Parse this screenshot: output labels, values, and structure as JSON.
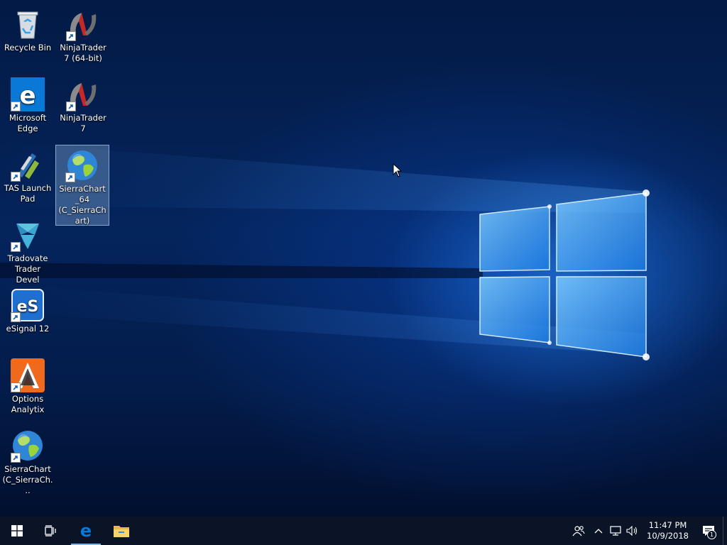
{
  "desktop": {
    "icons": [
      {
        "label": "Recycle Bin",
        "icon": "recycle-bin-icon"
      },
      {
        "label": "NinjaTrader 7 (64-bit)",
        "icon": "ninjatrader-icon"
      },
      {
        "label": "Microsoft Edge",
        "icon": "edge-icon"
      },
      {
        "label": "NinjaTrader 7",
        "icon": "ninjatrader-icon"
      },
      {
        "label": "TAS Launch Pad",
        "icon": "tas-launchpad-icon"
      },
      {
        "label": "SierraChart_64 (C_SierraChart)",
        "icon": "globe-icon",
        "selected": true
      },
      {
        "label": "Tradovate Trader Devel",
        "icon": "tradovate-icon"
      },
      {
        "label": "eSignal 12",
        "icon": "esignal-icon"
      },
      {
        "label": "Options Analytix",
        "icon": "options-analytix-icon"
      },
      {
        "label": "SierraChart (C_SierraCh...",
        "icon": "globe-icon"
      }
    ]
  },
  "taskbar": {
    "start": "windows-logo-icon",
    "task_view": "task-view-icon",
    "pinned": [
      {
        "name": "Microsoft Edge",
        "icon": "edge-icon",
        "active": true
      },
      {
        "name": "File Explorer",
        "icon": "file-explorer-icon"
      }
    ],
    "tray": {
      "icons": [
        "people-icon",
        "chevron-up-icon",
        "network-icon",
        "volume-icon"
      ],
      "time": "11:47 PM",
      "date": "10/9/2018",
      "notification_count": "1"
    }
  },
  "colors": {
    "taskbar": "#0b1426",
    "accent": "#76b9ed",
    "edge": "#0a78d7"
  }
}
